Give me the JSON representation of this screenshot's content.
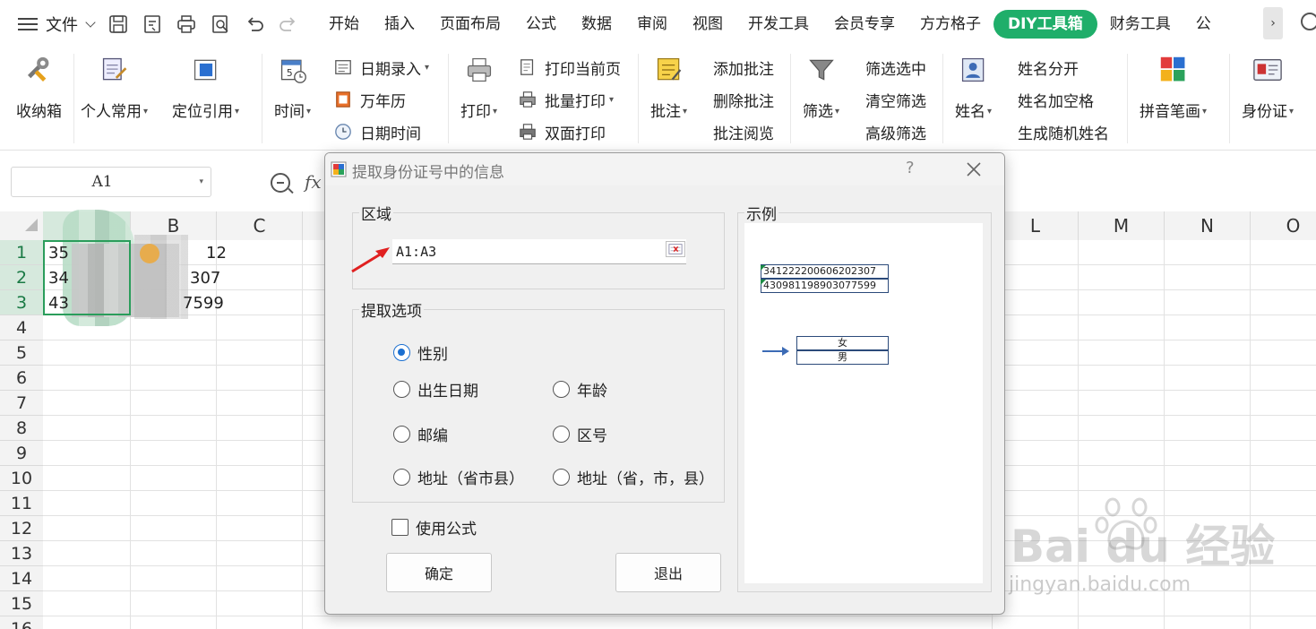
{
  "menubar": {
    "file_label": "文件",
    "tabs": [
      {
        "label": "开始"
      },
      {
        "label": "插入"
      },
      {
        "label": "页面布局"
      },
      {
        "label": "公式"
      },
      {
        "label": "数据"
      },
      {
        "label": "审阅"
      },
      {
        "label": "视图"
      },
      {
        "label": "开发工具"
      },
      {
        "label": "会员专享"
      },
      {
        "label": "方方格子"
      },
      {
        "label": "DIY工具箱"
      },
      {
        "label": "财务工具"
      },
      {
        "label": "公"
      }
    ],
    "more_label": "›"
  },
  "ribbon": {
    "toolbox": "收纳箱",
    "personal": "个人常用",
    "locate": "定位引用",
    "time": "时间",
    "date_entry": "日期录入",
    "calendar": "万年历",
    "datetime": "日期时间",
    "print": "打印",
    "print_current": "打印当前页",
    "batch_print": "批量打印",
    "duplex_print": "双面打印",
    "comment": "批注",
    "add_comment": "添加批注",
    "delete_comment": "删除批注",
    "read_comment": "批注阅览",
    "filter": "筛选",
    "filter_selected": "筛选选中",
    "clear_filter": "清空筛选",
    "advanced_filter": "高级筛选",
    "name": "姓名",
    "name_split": "姓名分开",
    "name_space": "姓名加空格",
    "random_name": "生成随机姓名",
    "pinyin": "拼音笔画",
    "id_card": "身份证"
  },
  "formula_bar": {
    "name_box": "A1",
    "fx": "fx"
  },
  "sheet": {
    "columns": [
      "B",
      "C",
      "L",
      "M",
      "N",
      "O"
    ],
    "rows": [
      "1",
      "2",
      "3",
      "4",
      "5",
      "6",
      "7",
      "8",
      "9",
      "10",
      "11",
      "12",
      "13",
      "14",
      "15",
      "16"
    ],
    "cells": {
      "a1": "35",
      "a2": "34",
      "a3": "43",
      "b1": "12",
      "b2": "307",
      "b3": "7599"
    }
  },
  "dialog": {
    "title": "提取身份证号中的信息",
    "help": "?",
    "region_legend": "区域",
    "range_value": "A1:A3",
    "options_legend": "提取选项",
    "options": {
      "gender": "性别",
      "birthdate": "出生日期",
      "age": "年龄",
      "postcode": "邮编",
      "area_code": "区号",
      "address_combined": "地址（省市县）",
      "address_separated": "地址（省，市，县）"
    },
    "use_formula": "使用公式",
    "ok": "确定",
    "exit": "退出",
    "example_legend": "示例",
    "example": {
      "id1": "341222200606202307",
      "id2": "430981198903077599",
      "out1": "女",
      "out2": "男"
    }
  },
  "watermark": {
    "brand": "Bai du 经验",
    "url": "jingyan.baidu.com"
  },
  "colors": {
    "accent_green": "#1fae6a",
    "selection_green": "#2a9d5b",
    "radio_blue": "#1b6fd0",
    "arrow_red": "#e02020"
  }
}
